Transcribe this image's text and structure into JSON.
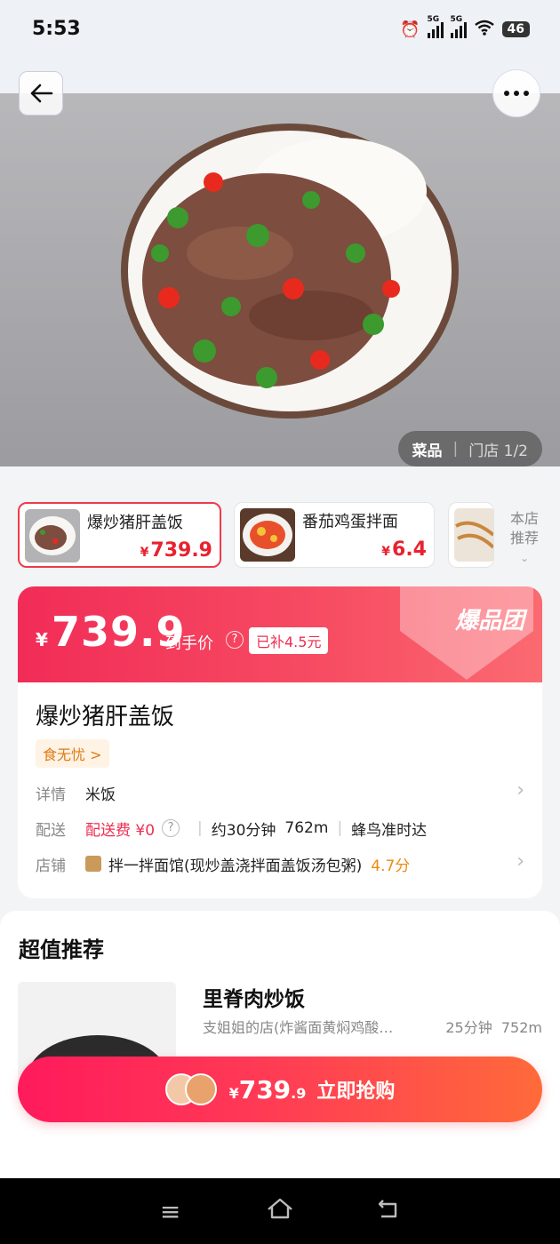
{
  "status_bar": {
    "time": "5:53",
    "signal_labels": [
      "5G",
      "5G"
    ],
    "battery": "46"
  },
  "hero": {
    "badge_active": "菜品",
    "badge_inactive": "门店 1/2"
  },
  "thumbs": [
    {
      "name": "爆炒猪肝盖饭",
      "price": "739.9",
      "currency": "¥"
    },
    {
      "name": "番茄鸡蛋拌面",
      "price": "6.4",
      "currency": "¥"
    }
  ],
  "store_recommend": "本店推荐",
  "banner": {
    "currency": "¥",
    "price": "739.9",
    "price_label": "到手价",
    "subsidy": "已补4.5元",
    "brand": "爆品团"
  },
  "detail": {
    "title": "爆炒猪肝盖饭",
    "tag": "食无忧 >",
    "rows": {
      "details_key": "详情",
      "details_value": "米饭",
      "delivery_key": "配送",
      "delivery_fee": "配送费 ¥0",
      "delivery_time": "约30分钟",
      "delivery_distance": "762m",
      "delivery_service": "蜂鸟准时达",
      "shop_key": "店铺",
      "shop_name": "拌一拌面馆(现炒盖浇拌面盖饭汤包粥)",
      "shop_rating": "4.7分"
    }
  },
  "recommend": {
    "heading": "超值推荐",
    "item": {
      "name": "里脊肉炒饭",
      "shop": "支姐姐的店(炸酱面黄焖鸡酸…",
      "time": "25分钟",
      "distance": "752m"
    }
  },
  "buy_bar": {
    "currency": "¥",
    "price_int": "739",
    "price_dec": ".9",
    "label": "立即抢购"
  },
  "colors": {
    "accent": "#f12c57",
    "price_red": "#e8222f",
    "rating_orange": "#ee8a12"
  },
  "icons": {
    "back": "arrow-left-icon",
    "more": "more-dots-icon",
    "nav_menu": "menu-icon",
    "nav_home": "home-icon",
    "nav_back": "back-icon"
  }
}
